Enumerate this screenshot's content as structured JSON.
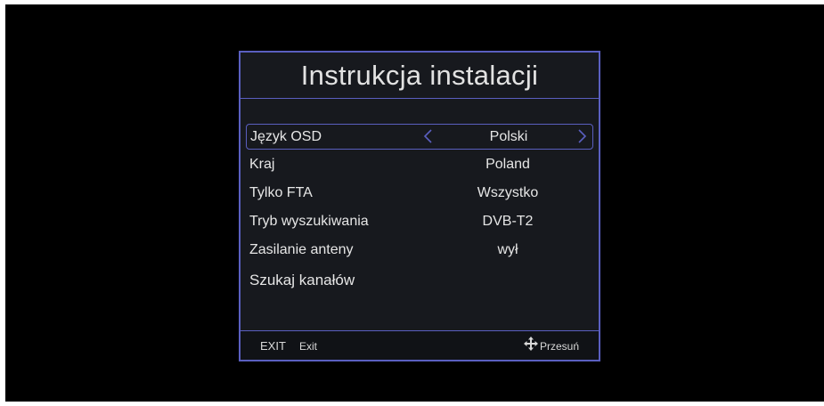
{
  "dialog": {
    "title": "Instrukcja instalacji",
    "items": [
      {
        "label": "Język OSD",
        "value": "Polski",
        "selected": true
      },
      {
        "label": "Kraj",
        "value": "Poland"
      },
      {
        "label": "Tylko FTA",
        "value": "Wszystko"
      },
      {
        "label": "Tryb wyszukiwania",
        "value": "DVB-T2"
      },
      {
        "label": "Zasilanie anteny",
        "value": "wył"
      },
      {
        "label": "Szukaj kanałów",
        "value": ""
      }
    ]
  },
  "footer": {
    "exit_key": "EXIT",
    "exit_label": "Exit",
    "move_icon": "move-arrows-icon",
    "move_label": "Przesuń"
  },
  "colors": {
    "border_accent": "#5a5fc0",
    "panel_bg": "#17191e",
    "screen_bg": "#000000",
    "text": "#e6e6e6"
  }
}
